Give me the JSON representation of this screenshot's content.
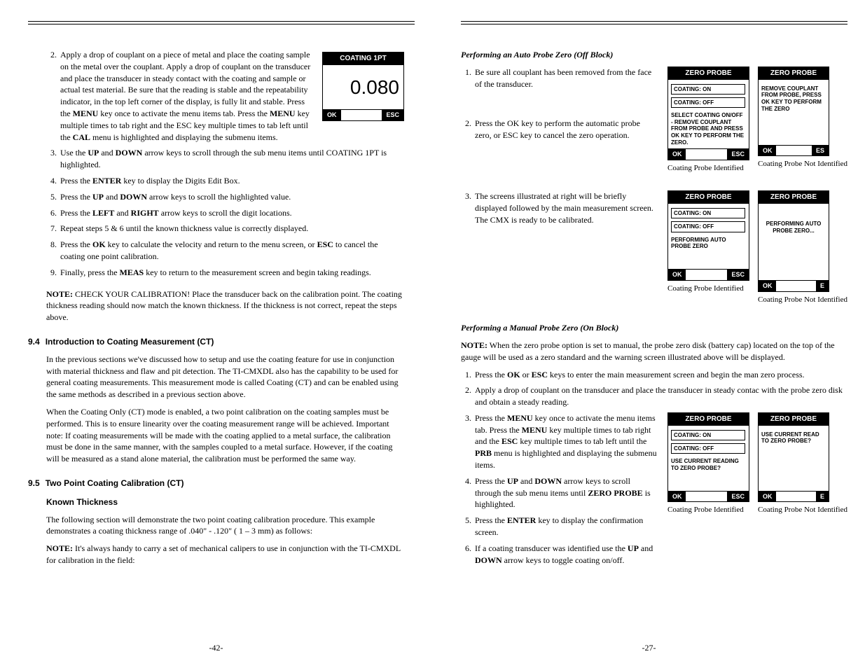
{
  "left": {
    "page_num": "-42-",
    "items": [
      "Apply a drop of couplant on a piece of metal and place the coating sample on the metal over the couplant. Apply a drop of couplant on the transducer and place the transducer in steady contact with the coating and sample or actual test material. Be sure that the reading is stable and the repeatability indicator, in the top left corner of the display, is fully lit and stable. Press the ",
      " key once to activate the menu items tab. Press the ",
      " key multiple times to tab right and the ESC key multiple times to tab left until the ",
      " menu is highlighted and displaying the submenu items.",
      "Use the ",
      " and ",
      " arrow keys to scroll through the sub menu items until COATING 1PT is highlighted.",
      "Press the ",
      " key to display the Digits Edit Box.",
      "Press the ",
      " and ",
      " arrow keys to scroll the highlighted value.",
      "Press the ",
      " and ",
      " arrow keys to scroll the digit locations.",
      "Repeat steps 5 & 6 until the known thickness value is correctly displayed.",
      "Press the ",
      " key to calculate the velocity and return to the menu screen, or ",
      " to cancel the coating one point calibration.",
      "Finally, press the ",
      " key to return to the measurement screen and begin taking readings."
    ],
    "keys": {
      "menu": "MENU",
      "cal": "CAL",
      "up": "UP",
      "down": "DOWN",
      "enter": "ENTER",
      "left": "LEFT",
      "right": "RIGHT",
      "ok": "OK",
      "esc": "ESC",
      "meas": "MEAS"
    },
    "note_label": "NOTE:",
    "note1": " CHECK YOUR CALIBRATION! Place the transducer back on the calibration point. The coating thickness reading should now match the known thickness. If the thickness is not correct, repeat the steps above.",
    "s94_num": "9.4",
    "s94_title": "Introduction to Coating Measurement (CT)",
    "s94_p1": "In the previous sections we've discussed how to setup and use the coating feature for use in conjunction with material thickness and flaw and pit detection. The TI-CMXDL also has the capability to be used for general coating measurements. This measurement mode is called Coating (CT) and can be enabled using the same methods as described in a previous section above.",
    "s94_p2": "When the Coating Only (CT) mode is enabled, a two point calibration on the coating samples must be performed. This is to ensure linearity over the coating measurement range will be achieved. Important note: If coating measurements will be made with the coating applied to a metal surface, the calibration must be done in the same manner, with the samples coupled to a metal surface. However, if the coating will be measured as a stand alone material, the calibration must be performed the same way.",
    "s95_num": "9.5",
    "s95_title": "Two Point Coating Calibration (CT)",
    "s95_sub": "Known Thickness",
    "s95_p1": "The following section will demonstrate the two point coating calibration procedure. This example demonstrates a coating thickness range of .040\" - .120\" ( 1 – 3 mm) as follows:",
    "s95_note": " It's always handy to carry a set of mechanical calipers to use in conjunction with the TI-CMXDL for calibration in the field:",
    "device1": {
      "header": "COATING 1PT",
      "big": "0.080",
      "ok": "OK",
      "esc": "ESC"
    }
  },
  "right": {
    "page_num": "-27-",
    "auto_title": "Performing an Auto Probe Zero (Off Block)",
    "step1": "Be sure all couplant has been removed from the face of the transducer.",
    "step2": "Press the OK key to perform the automatic probe zero, or ESC key to cancel the zero operation.",
    "step3": "The screens illustrated at right will be briefly displayed followed by the main measurement screen. The CMX is ready to be calibrated.",
    "manual_title": "Performing a Manual Probe Zero (On Block)",
    "note_label": "NOTE:",
    "manual_note": " When the zero probe option is set to manual, the probe zero disk (battery cap) located on the top of the gauge will be used as a zero standard and the warning screen illustrated above will be displayed.",
    "m1a": "Press the ",
    "m1b": " or ",
    "m1c": " keys to enter the main measurement screen and begin the man zero process.",
    "m2": "Apply a drop of couplant on the transducer and place the transducer in steady contac with the probe zero disk and obtain a steady reading.",
    "m3a": "Press the ",
    "m3b": " key once to activate the menu items tab. Press the ",
    "m3c": " key multiple times to tab right and the ",
    "m3d": " key multiple times to tab left until the ",
    "m3e": " menu is highlighted and displaying the submenu items.",
    "m4a": "Press the ",
    "m4b": " and ",
    "m4c": " arrow keys to scroll through the sub menu items until ",
    "m4d": " is highlighted.",
    "m5a": "Press the ",
    "m5b": " key to display the confirmation screen.",
    "m6a": "If a coating transducer was identified use the ",
    "m6b": " and ",
    "m6c": " arrow keys to toggle coating on/off.",
    "keys": {
      "ok": "OK",
      "esc": "ESC",
      "menu": "MENU",
      "prb": "PRB",
      "up": "UP",
      "down": "DOWN",
      "zero_probe": "ZERO PROBE",
      "enter": "ENTER"
    },
    "dev": {
      "header": "ZERO PROBE",
      "header2": "ZERO PROBE",
      "header3": "ZERO PROBE",
      "header4": "ZERO PROBE",
      "coat_on": "COATING:  ON",
      "coat_off": "COATING:  OFF",
      "txt1": "SELECT COATING ON/OFF - REMOVE COUPLANT FROM PROBE AND PRESS OK KEY TO PERFORM THE ZERO.",
      "txt2": "REMOVE COUPLANT FROM PROBE, PRESS OK KEY TO PERFORM THE ZERO",
      "txt3": "PERFORMING AUTO PROBE ZERO",
      "txt4": "PERFORMING AUTO PROBE ZERO...",
      "txt5": "USE CURRENT READING TO ZERO PROBE?",
      "txt6": "USE CURRENT READ TO ZERO PROBE?",
      "ok": "OK",
      "esc": "ESC",
      "es": "ES",
      "e": "E",
      "cap_id": "Coating Probe Identified",
      "cap_nid": "Coating Probe Not Identified"
    }
  }
}
